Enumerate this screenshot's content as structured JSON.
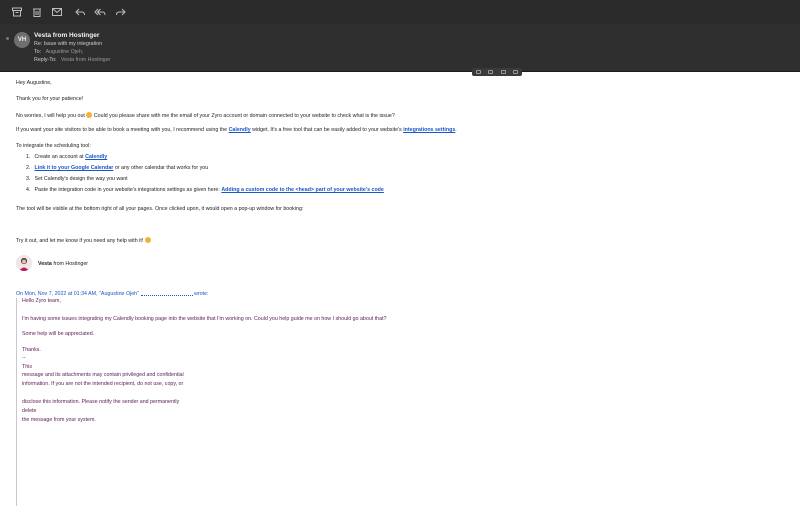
{
  "toolbar": {
    "icons": [
      "archive-icon",
      "trash-icon",
      "junk-icon",
      "reply-icon",
      "reply-all-icon",
      "forward-icon"
    ]
  },
  "header": {
    "avatar_initials": "VH",
    "from": "Vesta from Hostinger",
    "subject_label": "Re:",
    "subject": "Issue with my integration",
    "to_label": "To:",
    "to": "Augustine Ojeh,",
    "reply_to_label": "Reply-To:",
    "reply_to": "Vesta from Hostinger"
  },
  "body": {
    "greeting": "Hey Augustine,",
    "thanks": "Thank you for your patience!",
    "p1_before": "No worries, I will help you out",
    "p1_after": "Could you please share with me the email of your Zyro account or domain connected to your website to check what is the issue?",
    "p2_before": "If you want your site visitors to be able to book a meeting with you, I recommend using the",
    "p2_link1": "Calendly",
    "p2_mid": "widget. It's a free tool that can be easily added to your website's",
    "p2_link2": "integrations settings",
    "p2_end": ".",
    "intro": "To integrate the scheduling tool:",
    "steps": [
      {
        "num": "1.",
        "before": "Create an account at",
        "link": "Calendly",
        "after": ""
      },
      {
        "num": "2.",
        "before": "",
        "link": "Link it to your Google Calendar",
        "after": "or any other calendar that works for you"
      },
      {
        "num": "3.",
        "before": "Set Calendly's design the way you want",
        "link": "",
        "after": ""
      },
      {
        "num": "4.",
        "before": "Paste the integration code in your website's integrations settings as given here:",
        "link": "Adding a custom code to the <head> part of your website's code",
        "after": ""
      }
    ],
    "visible_note": "The tool will be visible at the bottom right of all your pages. Once clicked upon, it would open a pop-up window for booking:",
    "try_it": "Try it out, and let me know if you need any help with it!",
    "sig_name": "Vesta",
    "sig_rest": "from Hostinger"
  },
  "quote": {
    "header_before": "On Mon, Nov 7, 2022 at 01:34 AM, \"Augustine Ojeh\"",
    "header_after": "wrote:",
    "lines": [
      "Hello Zyro team,",
      "I'm having some issues integrating my Calendly booking page into the website that I'm working on. Could you help guide me on how I should go about that?",
      "Some help will be appreciated.",
      "Thanks.",
      "--",
      "This",
      "message and its attachments may contain privileged and confidential",
      "information. If you are not the intended recipient, do not use, copy, or",
      "disclose this information. Please notify the sender and permanently",
      "delete",
      "the message from your system."
    ]
  }
}
